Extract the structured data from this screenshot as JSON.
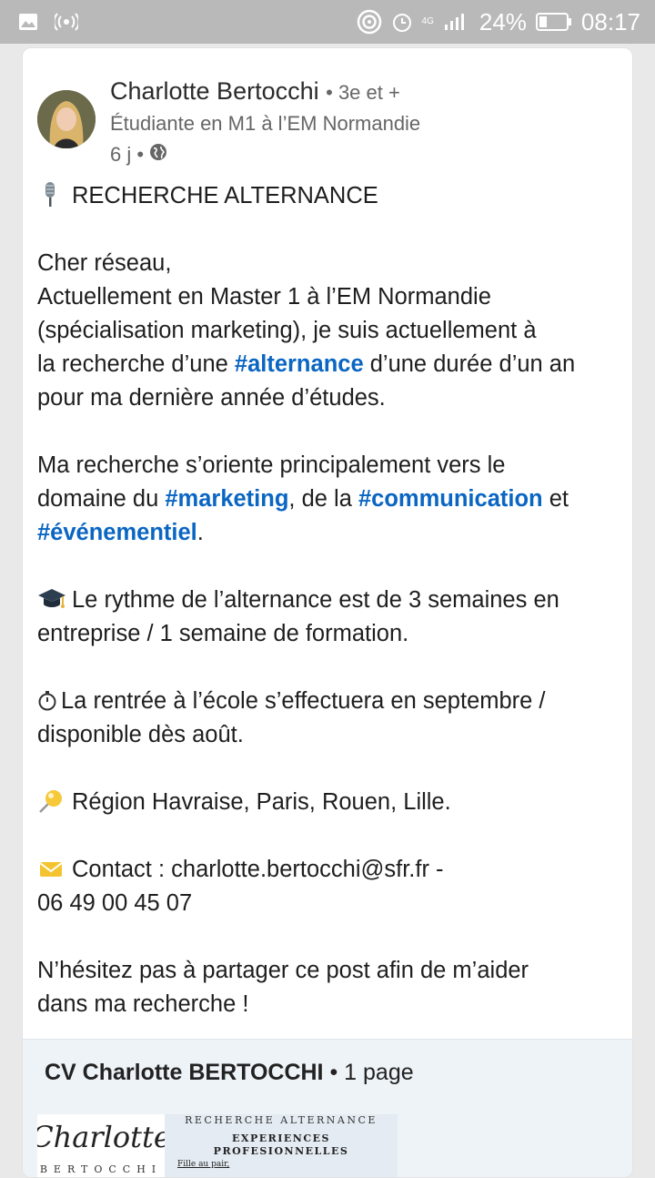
{
  "status_bar": {
    "network": "4G",
    "battery_percent": "24%",
    "time": "08:17"
  },
  "post": {
    "author": {
      "name": "Charlotte Bertocchi",
      "degree": "• 3e et +",
      "headline": "Étudiante en M1 à l’EM Normandie"
    },
    "time_ago": "6 j •",
    "lines": {
      "l1": "RECHERCHE ALTERNANCE",
      "l2": "Cher réseau,",
      "l3": "Actuellement en Master 1 à l’EM Normandie",
      "l4": "(spécialisation marketing), je suis actuellement à",
      "l5a": "la recherche d’une ",
      "tag_alternance": "#alternance",
      "l5b": " d’une durée d’un an",
      "l6": "pour ma dernière année d’études.",
      "l7": "Ma recherche s’oriente principalement vers le",
      "l8a": "domaine du ",
      "tag_marketing": "#marketing",
      "l8b": ", de la ",
      "tag_communication": "#communication",
      "l8c": " et",
      "tag_evenementiel": "#événementiel",
      "l9b": ".",
      "l10": "Le rythme de l’alternance est de 3 semaines en",
      "l11": "entreprise / 1 semaine de formation.",
      "l12": "La rentrée à l’école s’effectuera en septembre /",
      "l13": "disponible dès août.",
      "l14": "Région Havraise, Paris, Rouen, Lille.",
      "l15": "Contact : charlotte.bertocchi@sfr.fr -",
      "l16": "06 49 00 45 07",
      "l17": "N’hésitez pas à partager ce post afin de m’aider",
      "l18": "dans ma recherche !"
    },
    "icons": [
      "microphone-icon",
      "graduation-cap-icon",
      "stopwatch-icon",
      "pushpin-icon",
      "envelope-icon"
    ],
    "tag_color": "#0a66c2"
  },
  "document": {
    "title": "CV Charlotte BERTOCCHI",
    "pages": " • 1 page",
    "preview": {
      "logo_text": "Charlotte",
      "logo_sub": "BERTOCCHI",
      "heading": "RECHERCHE ALTERNANCE",
      "section": "EXPERIENCES PROFESIONNELLES",
      "item": "Fille au pair,"
    }
  }
}
